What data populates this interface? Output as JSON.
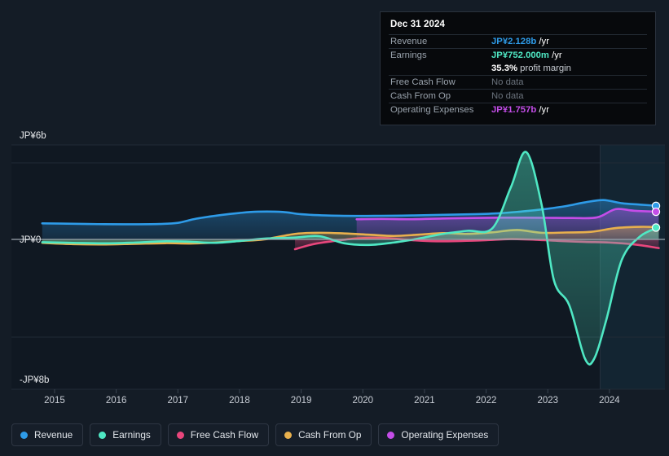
{
  "colors": {
    "background": "#141c26",
    "revenue": "#2e9be8",
    "earnings": "#4fe8c4",
    "free_cash_flow": "#e8467c",
    "cash_from_op": "#e8b04d",
    "operating_expenses": "#c44de8",
    "zero_line": "#9aa3ad",
    "grid": "#212a36"
  },
  "tooltip": {
    "date": "Dec 31 2024",
    "rows": [
      {
        "label": "Revenue",
        "value": "JP¥2.128b",
        "unit": "/yr",
        "color": "#2e9be8",
        "no_data": false
      },
      {
        "label": "Earnings",
        "value": "JP¥752.000m",
        "unit": "/yr",
        "color": "#4fe8c4",
        "no_data": false
      },
      {
        "label": "Free Cash Flow",
        "value": "No data",
        "unit": "",
        "color": "#6b737d",
        "no_data": true
      },
      {
        "label": "Cash From Op",
        "value": "No data",
        "unit": "",
        "color": "#6b737d",
        "no_data": true
      },
      {
        "label": "Operating Expenses",
        "value": "JP¥1.757b",
        "unit": "/yr",
        "color": "#c44de8",
        "no_data": false
      }
    ],
    "margin_pct": "35.3%",
    "margin_text": "profit margin"
  },
  "legend": {
    "items": [
      {
        "label": "Revenue",
        "color": "#2e9be8"
      },
      {
        "label": "Earnings",
        "color": "#4fe8c4"
      },
      {
        "label": "Free Cash Flow",
        "color": "#e8467c"
      },
      {
        "label": "Cash From Op",
        "color": "#e8b04d"
      },
      {
        "label": "Operating Expenses",
        "color": "#c44de8"
      }
    ]
  },
  "chart_data": {
    "type": "line",
    "title": "",
    "xlabel": "",
    "ylabel": "",
    "currency": "JP¥",
    "grid": true,
    "legend_position": "bottom",
    "ylim": [
      -8,
      6
    ],
    "y_ticks": [
      6,
      0,
      -8
    ],
    "y_tick_labels": [
      "JP¥6b",
      "JP¥0",
      "-JP¥8b"
    ],
    "xlim": [
      2014.3,
      2024.9
    ],
    "x_ticks": [
      2015,
      2016,
      2017,
      2018,
      2019,
      2020,
      2021,
      2022,
      2023,
      2024
    ],
    "x_tick_labels": [
      "2015",
      "2016",
      "2017",
      "2018",
      "2019",
      "2020",
      "2021",
      "2022",
      "2023",
      "2024"
    ],
    "highlight_region": {
      "from": 2023.85,
      "to": 2024.9,
      "note": "lighter shaded recent period"
    },
    "series": [
      {
        "name": "Revenue",
        "color": "#2e9be8",
        "filled": true,
        "x": [
          2014.8,
          2015.2,
          2015.7,
          2016.2,
          2016.7,
          2017.0,
          2017.3,
          2017.7,
          2018.0,
          2018.3,
          2018.7,
          2019.0,
          2019.4,
          2019.9,
          2020.3,
          2020.8,
          2021.3,
          2021.8,
          2022.2,
          2022.6,
          2023.0,
          2023.3,
          2023.6,
          2023.9,
          2024.2,
          2024.5,
          2024.8
        ],
        "values": [
          1.02,
          1.0,
          0.97,
          0.96,
          0.98,
          1.05,
          1.32,
          1.55,
          1.68,
          1.76,
          1.74,
          1.6,
          1.52,
          1.49,
          1.5,
          1.52,
          1.56,
          1.6,
          1.66,
          1.78,
          1.95,
          2.12,
          2.35,
          2.5,
          2.3,
          2.21,
          2.128
        ]
      },
      {
        "name": "Earnings",
        "color": "#4fe8c4",
        "filled": true,
        "x": [
          2014.8,
          2015.3,
          2015.8,
          2016.3,
          2016.8,
          2017.2,
          2017.6,
          2018.0,
          2018.4,
          2018.9,
          2019.3,
          2019.7,
          2020.1,
          2020.5,
          2020.9,
          2021.3,
          2021.7,
          2022.1,
          2022.4,
          2022.65,
          2022.9,
          2023.1,
          2023.35,
          2023.6,
          2023.75,
          2023.95,
          2024.2,
          2024.5,
          2024.8
        ],
        "values": [
          -0.18,
          -0.22,
          -0.25,
          -0.2,
          -0.12,
          -0.15,
          -0.22,
          -0.1,
          0.05,
          0.12,
          0.2,
          -0.25,
          -0.35,
          -0.2,
          0.05,
          0.35,
          0.55,
          0.7,
          3.3,
          5.55,
          2.2,
          -2.6,
          -4.2,
          -7.55,
          -7.6,
          -5.1,
          -1.3,
          0.2,
          0.752
        ]
      },
      {
        "name": "Free Cash Flow",
        "color": "#e8467c",
        "filled": true,
        "x": [
          2018.9,
          2019.2,
          2019.5,
          2019.9,
          2020.3,
          2020.8,
          2021.2,
          2021.6,
          2022.0,
          2022.4,
          2022.8,
          2023.2,
          2023.6,
          2024.0,
          2024.4,
          2024.8
        ],
        "values": [
          -0.62,
          -0.3,
          -0.12,
          0.06,
          0.1,
          -0.05,
          -0.12,
          -0.1,
          -0.05,
          0.02,
          -0.02,
          -0.1,
          -0.16,
          -0.2,
          -0.32,
          -0.55
        ]
      },
      {
        "name": "Cash From Op",
        "color": "#e8b04d",
        "filled": true,
        "x": [
          2014.8,
          2015.3,
          2015.8,
          2016.3,
          2016.8,
          2017.2,
          2017.6,
          2018.0,
          2018.4,
          2018.9,
          2019.3,
          2019.7,
          2020.1,
          2020.5,
          2020.9,
          2021.3,
          2021.7,
          2022.1,
          2022.5,
          2022.9,
          2023.3,
          2023.7,
          2024.1,
          2024.5,
          2024.8
        ],
        "values": [
          -0.22,
          -0.3,
          -0.32,
          -0.28,
          -0.24,
          -0.26,
          -0.2,
          -0.1,
          0.0,
          0.35,
          0.42,
          0.38,
          0.3,
          0.22,
          0.3,
          0.4,
          0.35,
          0.45,
          0.6,
          0.42,
          0.44,
          0.48,
          0.72,
          0.8,
          0.78
        ]
      },
      {
        "name": "Operating Expenses",
        "color": "#c44de8",
        "filled": true,
        "x": [
          2019.9,
          2020.3,
          2020.8,
          2021.3,
          2021.8,
          2022.2,
          2022.6,
          2023.0,
          2023.4,
          2023.8,
          2024.1,
          2024.4,
          2024.8
        ],
        "values": [
          1.28,
          1.3,
          1.28,
          1.33,
          1.36,
          1.38,
          1.38,
          1.37,
          1.36,
          1.4,
          1.92,
          1.82,
          1.757
        ]
      }
    ],
    "endpoint_markers": [
      {
        "series": "Revenue",
        "value": 2.128,
        "color": "#2e9be8"
      },
      {
        "series": "Operating Expenses",
        "value": 1.757,
        "color": "#c44de8"
      },
      {
        "series": "Earnings",
        "value": 0.752,
        "color": "#4fe8c4"
      }
    ]
  }
}
